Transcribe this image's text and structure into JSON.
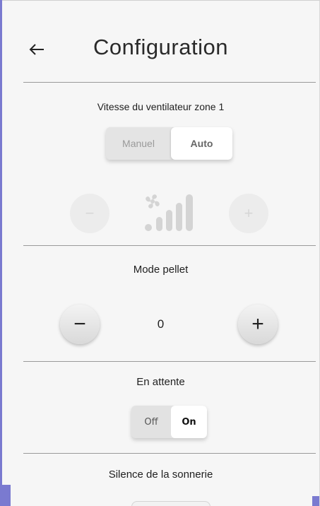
{
  "header": {
    "back_icon": "arrow-left-icon",
    "title": "Configuration"
  },
  "fan_speed": {
    "label": "Vitesse du ventilateur zone 1",
    "mode_options": [
      "Manuel",
      "Auto"
    ],
    "selected_mode": "Auto",
    "minus_label": "−",
    "plus_label": "+",
    "fan_icon": "fan-speed-icon",
    "level_bars_lit": 0,
    "level_bars_total": 4
  },
  "pellet_mode": {
    "label": "Mode pellet",
    "minus_label": "−",
    "plus_label": "+",
    "value": "0"
  },
  "standby": {
    "label": "En attente",
    "off_label": "Off",
    "on_label": "On",
    "selected": "On"
  },
  "ringer_silence": {
    "label": "Silence de la sonnerie"
  },
  "colors": {
    "accent": "#7a7ad0",
    "panel_bg": "#f6f6f6",
    "disabled": "#d6d6d6"
  }
}
